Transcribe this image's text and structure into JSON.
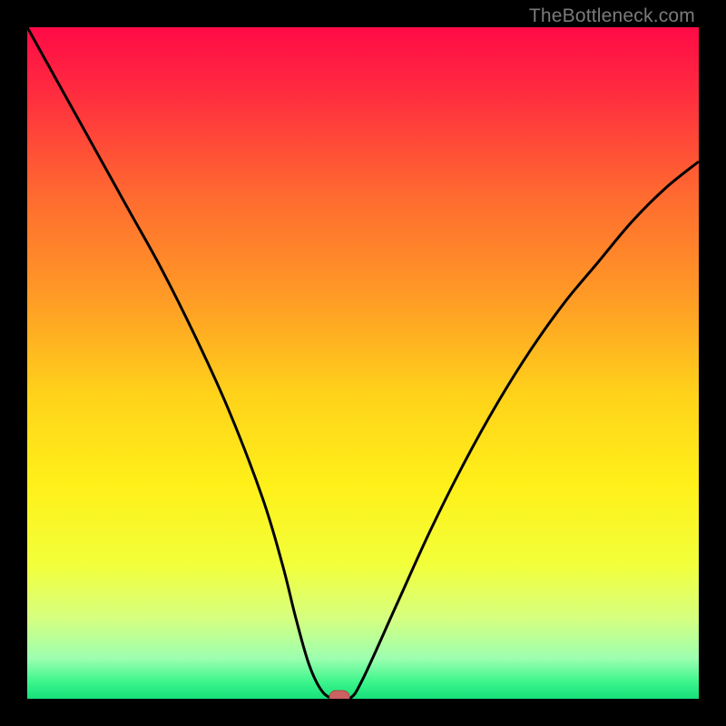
{
  "watermark": "TheBottleneck.com",
  "chart_data": {
    "type": "line",
    "title": "",
    "xlabel": "",
    "ylabel": "",
    "xlim": [
      0,
      100
    ],
    "ylim": [
      0,
      100
    ],
    "series": [
      {
        "name": "bottleneck-curve",
        "x": [
          0,
          5,
          10,
          15,
          20,
          25,
          30,
          35,
          38,
          40,
          42,
          44,
          46,
          48,
          50,
          55,
          60,
          65,
          70,
          75,
          80,
          85,
          90,
          95,
          100
        ],
        "y": [
          100,
          91,
          82,
          73,
          64,
          54,
          43,
          30,
          20,
          12,
          5,
          1,
          0,
          0,
          3,
          14,
          25,
          35,
          44,
          52,
          59,
          65,
          71,
          76,
          80
        ]
      }
    ],
    "marker": {
      "x": 46.5,
      "y": 0
    },
    "gradient_stops": [
      {
        "offset": 0.0,
        "color": "#ff0a46"
      },
      {
        "offset": 0.1,
        "color": "#ff2d3f"
      },
      {
        "offset": 0.25,
        "color": "#ff6a30"
      },
      {
        "offset": 0.4,
        "color": "#ff9a26"
      },
      {
        "offset": 0.55,
        "color": "#ffd31a"
      },
      {
        "offset": 0.68,
        "color": "#fff019"
      },
      {
        "offset": 0.8,
        "color": "#f2ff3a"
      },
      {
        "offset": 0.88,
        "color": "#d6ff80"
      },
      {
        "offset": 0.94,
        "color": "#9cffb0"
      },
      {
        "offset": 0.975,
        "color": "#3cf58c"
      },
      {
        "offset": 1.0,
        "color": "#17e07a"
      }
    ],
    "colors": {
      "curve": "#000000",
      "marker_fill": "#cb6161",
      "marker_stroke": "#a84c4c",
      "frame": "#000000"
    }
  }
}
